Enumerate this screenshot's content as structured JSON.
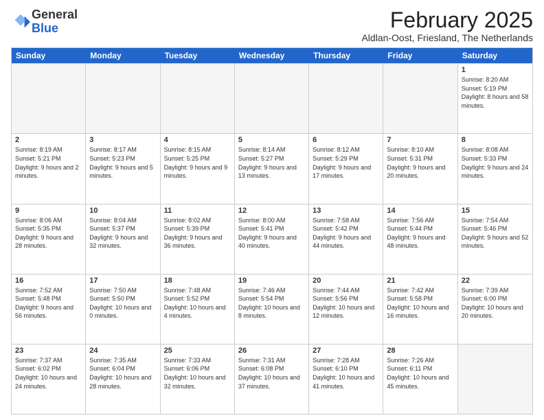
{
  "logo": {
    "general": "General",
    "blue": "Blue"
  },
  "title": "February 2025",
  "subtitle": "Aldlan-Oost, Friesland, The Netherlands",
  "headers": [
    "Sunday",
    "Monday",
    "Tuesday",
    "Wednesday",
    "Thursday",
    "Friday",
    "Saturday"
  ],
  "rows": [
    [
      {
        "date": "",
        "info": "",
        "empty": true
      },
      {
        "date": "",
        "info": "",
        "empty": true
      },
      {
        "date": "",
        "info": "",
        "empty": true
      },
      {
        "date": "",
        "info": "",
        "empty": true
      },
      {
        "date": "",
        "info": "",
        "empty": true
      },
      {
        "date": "",
        "info": "",
        "empty": true
      },
      {
        "date": "1",
        "info": "Sunrise: 8:20 AM\nSunset: 5:19 PM\nDaylight: 8 hours and 58 minutes."
      }
    ],
    [
      {
        "date": "2",
        "info": "Sunrise: 8:19 AM\nSunset: 5:21 PM\nDaylight: 9 hours and 2 minutes."
      },
      {
        "date": "3",
        "info": "Sunrise: 8:17 AM\nSunset: 5:23 PM\nDaylight: 9 hours and 5 minutes."
      },
      {
        "date": "4",
        "info": "Sunrise: 8:15 AM\nSunset: 5:25 PM\nDaylight: 9 hours and 9 minutes."
      },
      {
        "date": "5",
        "info": "Sunrise: 8:14 AM\nSunset: 5:27 PM\nDaylight: 9 hours and 13 minutes."
      },
      {
        "date": "6",
        "info": "Sunrise: 8:12 AM\nSunset: 5:29 PM\nDaylight: 9 hours and 17 minutes."
      },
      {
        "date": "7",
        "info": "Sunrise: 8:10 AM\nSunset: 5:31 PM\nDaylight: 9 hours and 20 minutes."
      },
      {
        "date": "8",
        "info": "Sunrise: 8:08 AM\nSunset: 5:33 PM\nDaylight: 9 hours and 24 minutes."
      }
    ],
    [
      {
        "date": "9",
        "info": "Sunrise: 8:06 AM\nSunset: 5:35 PM\nDaylight: 9 hours and 28 minutes."
      },
      {
        "date": "10",
        "info": "Sunrise: 8:04 AM\nSunset: 5:37 PM\nDaylight: 9 hours and 32 minutes."
      },
      {
        "date": "11",
        "info": "Sunrise: 8:02 AM\nSunset: 5:39 PM\nDaylight: 9 hours and 36 minutes."
      },
      {
        "date": "12",
        "info": "Sunrise: 8:00 AM\nSunset: 5:41 PM\nDaylight: 9 hours and 40 minutes."
      },
      {
        "date": "13",
        "info": "Sunrise: 7:58 AM\nSunset: 5:42 PM\nDaylight: 9 hours and 44 minutes."
      },
      {
        "date": "14",
        "info": "Sunrise: 7:56 AM\nSunset: 5:44 PM\nDaylight: 9 hours and 48 minutes."
      },
      {
        "date": "15",
        "info": "Sunrise: 7:54 AM\nSunset: 5:46 PM\nDaylight: 9 hours and 52 minutes."
      }
    ],
    [
      {
        "date": "16",
        "info": "Sunrise: 7:52 AM\nSunset: 5:48 PM\nDaylight: 9 hours and 56 minutes."
      },
      {
        "date": "17",
        "info": "Sunrise: 7:50 AM\nSunset: 5:50 PM\nDaylight: 10 hours and 0 minutes."
      },
      {
        "date": "18",
        "info": "Sunrise: 7:48 AM\nSunset: 5:52 PM\nDaylight: 10 hours and 4 minutes."
      },
      {
        "date": "19",
        "info": "Sunrise: 7:46 AM\nSunset: 5:54 PM\nDaylight: 10 hours and 8 minutes."
      },
      {
        "date": "20",
        "info": "Sunrise: 7:44 AM\nSunset: 5:56 PM\nDaylight: 10 hours and 12 minutes."
      },
      {
        "date": "21",
        "info": "Sunrise: 7:42 AM\nSunset: 5:58 PM\nDaylight: 10 hours and 16 minutes."
      },
      {
        "date": "22",
        "info": "Sunrise: 7:39 AM\nSunset: 6:00 PM\nDaylight: 10 hours and 20 minutes."
      }
    ],
    [
      {
        "date": "23",
        "info": "Sunrise: 7:37 AM\nSunset: 6:02 PM\nDaylight: 10 hours and 24 minutes."
      },
      {
        "date": "24",
        "info": "Sunrise: 7:35 AM\nSunset: 6:04 PM\nDaylight: 10 hours and 28 minutes."
      },
      {
        "date": "25",
        "info": "Sunrise: 7:33 AM\nSunset: 6:06 PM\nDaylight: 10 hours and 32 minutes."
      },
      {
        "date": "26",
        "info": "Sunrise: 7:31 AM\nSunset: 6:08 PM\nDaylight: 10 hours and 37 minutes."
      },
      {
        "date": "27",
        "info": "Sunrise: 7:28 AM\nSunset: 6:10 PM\nDaylight: 10 hours and 41 minutes."
      },
      {
        "date": "28",
        "info": "Sunrise: 7:26 AM\nSunset: 6:11 PM\nDaylight: 10 hours and 45 minutes."
      },
      {
        "date": "",
        "info": "",
        "empty": true
      }
    ]
  ]
}
